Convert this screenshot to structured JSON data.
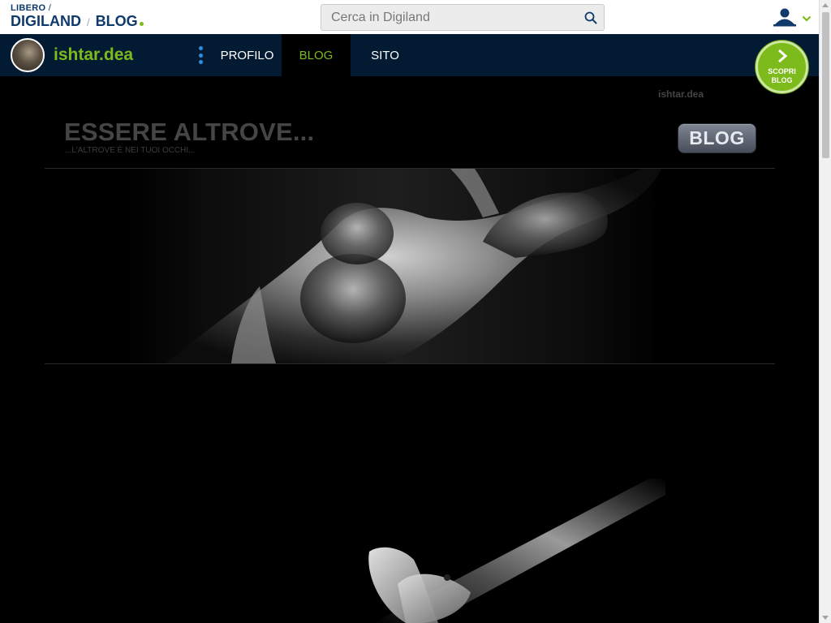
{
  "header": {
    "logo_top": "LIBERO",
    "logo_top_sep": "/",
    "logo_left": "DIGILAND",
    "logo_sep": "/",
    "logo_right": "BLOG",
    "search": {
      "placeholder": "Cerca in Digiland",
      "value": ""
    },
    "icons": {
      "search": "search-icon",
      "user": "user-icon",
      "dropdown": "chevron-down-icon"
    },
    "colors": {
      "brand_blue": "#0f3a6b",
      "accent_green": "#7cbb1b",
      "nav_bg": "#021b33"
    }
  },
  "nav": {
    "username": "ishtar.dea",
    "items": [
      {
        "label": "PROFILO",
        "active": false
      },
      {
        "label": "BLOG",
        "active": true
      },
      {
        "label": "SITO",
        "active": false
      }
    ],
    "scopri": {
      "line1": "SCOPRI",
      "line2": "BLOG"
    }
  },
  "blog": {
    "owner": "ishtar.dea",
    "title": "ESSERE ALTROVE...",
    "subtitle": "...L'ALTROVE È NEI TUOI OCCHI...",
    "badge": "BLOG"
  }
}
